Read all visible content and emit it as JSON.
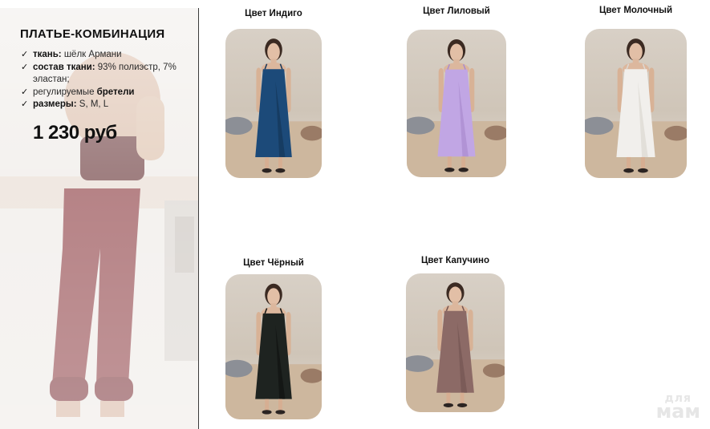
{
  "product": {
    "title": "ПЛАТЬЕ-КОМБИНАЦИЯ",
    "features": [
      {
        "bold": "ткань:",
        "text": " шёлк Армани",
        "tail": ""
      },
      {
        "bold": "состав ткани:",
        "text": " 93% полиэстр, 7% эластан;",
        "tail": ""
      },
      {
        "bold": "",
        "text": "регулируемые ",
        "tail": "бретели"
      },
      {
        "bold": "размеры:",
        "text": " S, M, L",
        "tail": ""
      }
    ],
    "price": "1 230 руб"
  },
  "colors": [
    {
      "label": "Цвет Индиго",
      "dress_color": "#1c4a79",
      "dress_shade": "#143659"
    },
    {
      "label": "Цвет Лиловый",
      "dress_color": "#c1a6e4",
      "dress_shade": "#a98ccf"
    },
    {
      "label": "Цвет Молочный",
      "dress_color": "#f1efec",
      "dress_shade": "#dcd8d2"
    },
    {
      "label": "Цвет Чёрный",
      "dress_color": "#1e2320",
      "dress_shade": "#0f1211"
    },
    {
      "label": "Цвет Капучино",
      "dress_color": "#8c6a66",
      "dress_shade": "#735552"
    }
  ],
  "watermark": {
    "line1": "для",
    "line2": "мам"
  }
}
